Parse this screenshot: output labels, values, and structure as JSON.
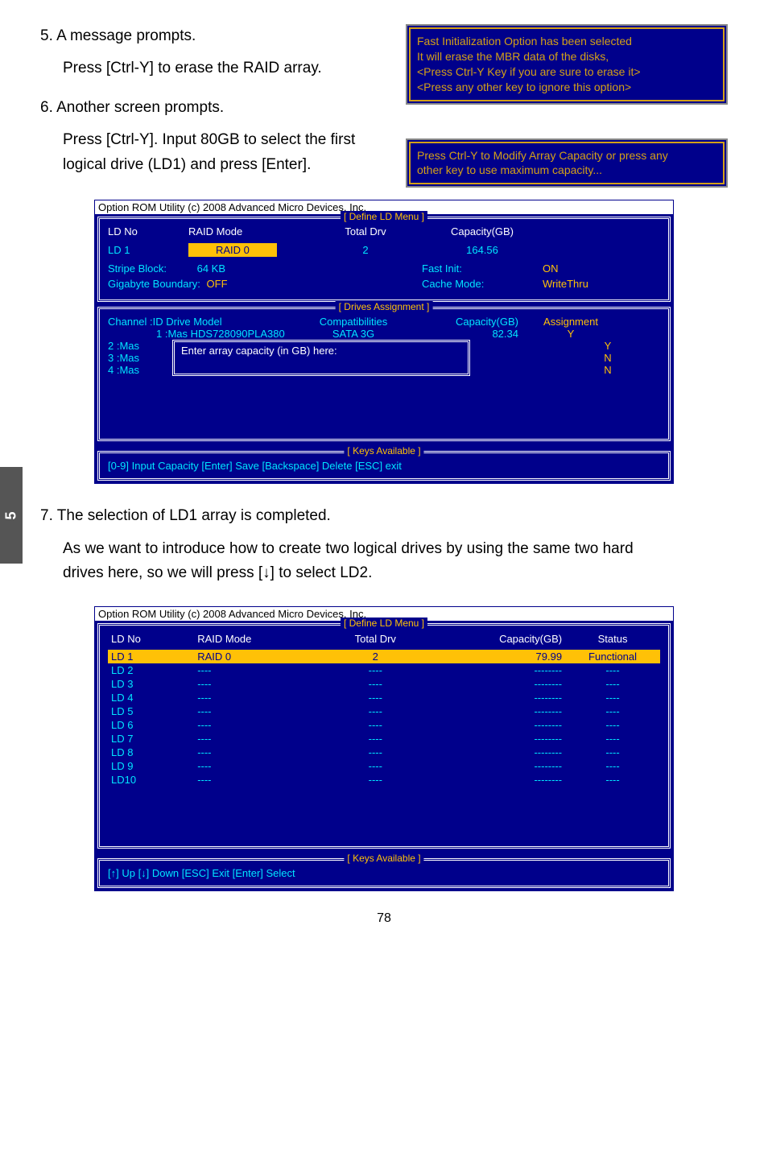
{
  "side_tab": "5",
  "step5": {
    "title": "5. A message prompts.",
    "body": "Press [Ctrl-Y] to erase the RAID array."
  },
  "step6": {
    "title": "6. Another screen prompts.",
    "body1": "Press [Ctrl-Y]. Input 80GB to select the first",
    "body2": "logical drive (LD1) and press [Enter]."
  },
  "msg1": {
    "l1": "Fast Initialization Option has been selected",
    "l2": "It will erase the MBR data of the disks,",
    "l3": "<Press Ctrl-Y Key if you are sure to erase it>",
    "l4": "<Press any other key to ignore this option>"
  },
  "msg2": {
    "l1": "Press Ctrl-Y to Modify Array Capacity or press any",
    "l2": "other key to use maximum capacity..."
  },
  "bios1": {
    "rom_title": "Option ROM Utility (c) 2008 Advanced Micro Devices, Inc.",
    "define_label": "[ Define LD Menu ]",
    "hdr": {
      "c1": "LD No",
      "c2": "RAID Mode",
      "c3": "Total Drv",
      "c4": "Capacity(GB)"
    },
    "row": {
      "c1": "LD  1",
      "c2": "RAID 0",
      "c3": "2",
      "c4": "164.56"
    },
    "stripe_lbl": "Stripe Block:",
    "stripe_val": "64   KB",
    "gig_lbl": "Gigabyte Boundary:",
    "gig_val": "OFF",
    "fast_lbl": "Fast Init:",
    "fast_val": "ON",
    "cache_lbl": "Cache Mode:",
    "cache_val": "WriteThru",
    "drives_label": "[ Drives Assignment ]",
    "dhdr": {
      "d1": "Channel  :ID  Drive Model",
      "d2": "Compatibilities",
      "d3": "Capacity(GB)",
      "d4": "Assignment"
    },
    "drow": {
      "d1": "1 :Mas HDS728090PLA380",
      "d2": "SATA  3G",
      "d3": "82.34",
      "d4": "Y"
    },
    "r2": "2 :Mas",
    "r3": "3 :Mas",
    "r4": "4 :Mas",
    "a2": "Y",
    "a3": "N",
    "a4": "N",
    "input_label": "Enter array capacity (in GB) here:",
    "keys_label": "[ Keys Available ]",
    "keys": "[0-9] Input Capacity        [Enter] Save        [Backspace] Delete          [ESC] exit"
  },
  "step7": {
    "title": "7. The selection of LD1 array is completed.",
    "body1": "As we want to introduce how to create two logical drives by using the same two hard",
    "body2": "drives here, so we will press [↓] to select LD2."
  },
  "bios2": {
    "rom_title": "Option ROM Utility (c) 2008 Advanced Micro Devices, Inc.",
    "define_label": "[ Define LD Menu ]",
    "hdr": {
      "c1": "LD No",
      "c2": "RAID Mode",
      "c3": "Total Drv",
      "c4": "Capacity(GB)",
      "c5": "Status"
    },
    "rows": [
      {
        "c1": "LD   1",
        "c2": "RAID 0",
        "c3": "2",
        "c4": "79.99",
        "c5": "Functional",
        "sel": true
      },
      {
        "c1": "LD   2",
        "c2": "----",
        "c3": "----",
        "c4": "--------",
        "c5": "----"
      },
      {
        "c1": "LD   3",
        "c2": "----",
        "c3": "----",
        "c4": "--------",
        "c5": "----"
      },
      {
        "c1": "LD   4",
        "c2": "----",
        "c3": "----",
        "c4": "--------",
        "c5": "----"
      },
      {
        "c1": "LD   5",
        "c2": "----",
        "c3": "----",
        "c4": "--------",
        "c5": "----"
      },
      {
        "c1": "LD   6",
        "c2": "----",
        "c3": "----",
        "c4": "--------",
        "c5": "----"
      },
      {
        "c1": "LD   7",
        "c2": "----",
        "c3": "----",
        "c4": "--------",
        "c5": "----"
      },
      {
        "c1": "LD   8",
        "c2": "----",
        "c3": "----",
        "c4": "--------",
        "c5": "----"
      },
      {
        "c1": "LD   9",
        "c2": "----",
        "c3": "----",
        "c4": "--------",
        "c5": "----"
      },
      {
        "c1": "LD10",
        "c2": "----",
        "c3": "----",
        "c4": "--------",
        "c5": "----"
      }
    ],
    "keys_label": "[ Keys Available ]",
    "keys": "[↑] Up     [↓] Down     [ESC] Exit     [Enter] Select"
  },
  "pagenum": "78"
}
